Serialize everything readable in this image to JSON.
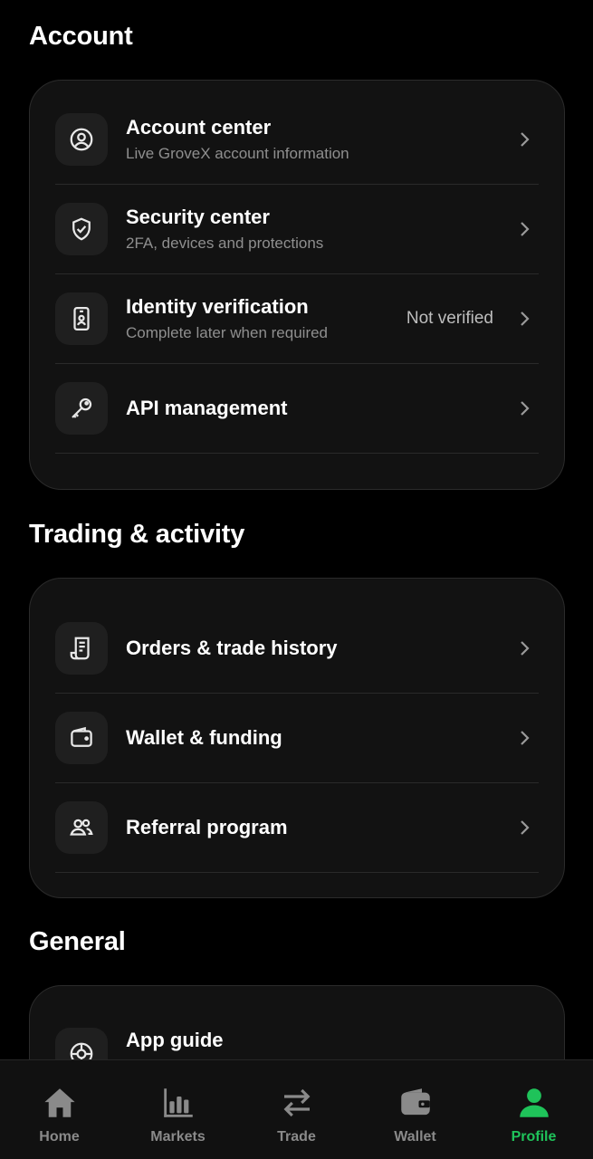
{
  "colors": {
    "accent": "#1fc35a",
    "muted": "#8a8a8a",
    "card": "#121212"
  },
  "sections": [
    {
      "title": "Account",
      "items": [
        {
          "icon": "user-circle-icon",
          "title": "Account center",
          "subtitle": "Live GroveX account information"
        },
        {
          "icon": "shield-check-icon",
          "title": "Security center",
          "subtitle": "2FA, devices and protections"
        },
        {
          "icon": "id-card-icon",
          "title": "Identity verification",
          "subtitle": "Complete later when required",
          "status": "Not verified"
        },
        {
          "icon": "key-icon",
          "title": "API management"
        }
      ]
    },
    {
      "title": "Trading & activity",
      "items": [
        {
          "icon": "receipt-icon",
          "title": "Orders & trade history"
        },
        {
          "icon": "wallet-icon",
          "title": "Wallet & funding"
        },
        {
          "icon": "users-icon",
          "title": "Referral program"
        }
      ]
    },
    {
      "title": "General",
      "items": [
        {
          "icon": "lifebuoy-icon",
          "title": "App guide"
        }
      ]
    }
  ],
  "tabbar": [
    {
      "icon": "home-icon",
      "label": "Home"
    },
    {
      "icon": "bar-chart-icon",
      "label": "Markets"
    },
    {
      "icon": "swap-icon",
      "label": "Trade"
    },
    {
      "icon": "wallet-icon",
      "label": "Wallet"
    },
    {
      "icon": "profile-icon",
      "label": "Profile",
      "active": true
    }
  ]
}
